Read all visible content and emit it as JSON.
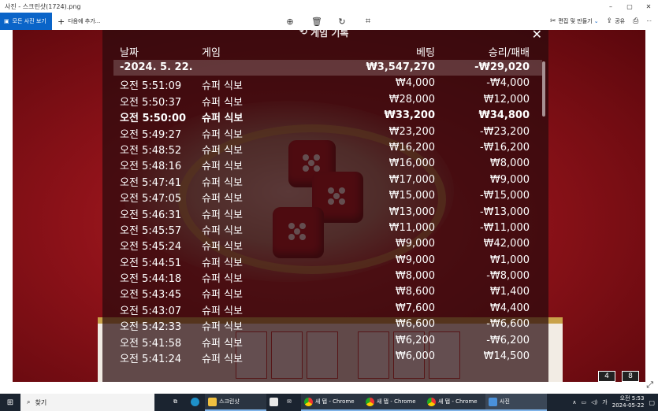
{
  "window": {
    "title": "사진 - 스크린샷(1724).png",
    "controls": [
      "–",
      "▢",
      "✕"
    ]
  },
  "toolbar": {
    "all_photos_label": "모든 사진 보기",
    "add_to_label": "다음에 추가...",
    "edit_label": "편집 및 만들기",
    "share_label": "공유",
    "center_icons": [
      "zoom-in-icon",
      "delete-icon",
      "rotate-icon",
      "crop-icon"
    ]
  },
  "modal": {
    "title": "게임 기록",
    "columns": {
      "date": "날짜",
      "game": "게임",
      "bet": "베팅",
      "win": "승리/패배"
    },
    "summary": {
      "date": "-2024. 5. 22.",
      "bet": "₩3,547,270",
      "win": "-₩29,020"
    },
    "rows": [
      {
        "time": "오전 5:51:09",
        "game": "슈퍼 식보",
        "bet": "₩4,000",
        "win": "-₩4,000"
      },
      {
        "time": "오전 5:50:37",
        "game": "슈퍼 식보",
        "bet": "₩28,000",
        "win": "₩12,000"
      },
      {
        "time": "오전 5:50:00",
        "game": "슈퍼 식보",
        "bet": "₩33,200",
        "win": "₩34,800"
      },
      {
        "time": "오전 5:49:27",
        "game": "슈퍼 식보",
        "bet": "₩23,200",
        "win": "-₩23,200"
      },
      {
        "time": "오전 5:48:52",
        "game": "슈퍼 식보",
        "bet": "₩16,200",
        "win": "-₩16,200"
      },
      {
        "time": "오전 5:48:16",
        "game": "슈퍼 식보",
        "bet": "₩16,000",
        "win": "₩8,000"
      },
      {
        "time": "오전 5:47:41",
        "game": "슈퍼 식보",
        "bet": "₩17,000",
        "win": "₩9,000"
      },
      {
        "time": "오전 5:47:05",
        "game": "슈퍼 식보",
        "bet": "₩15,000",
        "win": "-₩15,000"
      },
      {
        "time": "오전 5:46:31",
        "game": "슈퍼 식보",
        "bet": "₩13,000",
        "win": "-₩13,000"
      },
      {
        "time": "오전 5:45:57",
        "game": "슈퍼 식보",
        "bet": "₩11,000",
        "win": "-₩11,000"
      },
      {
        "time": "오전 5:45:24",
        "game": "슈퍼 식보",
        "bet": "₩9,000",
        "win": "₩42,000"
      },
      {
        "time": "오전 5:44:51",
        "game": "슈퍼 식보",
        "bet": "₩9,000",
        "win": "₩1,000"
      },
      {
        "time": "오전 5:44:18",
        "game": "슈퍼 식보",
        "bet": "₩8,000",
        "win": "-₩8,000"
      },
      {
        "time": "오전 5:43:45",
        "game": "슈퍼 식보",
        "bet": "₩8,600",
        "win": "₩1,400"
      },
      {
        "time": "오전 5:43:07",
        "game": "슈퍼 식보",
        "bet": "₩7,600",
        "win": "₩4,400"
      },
      {
        "time": "오전 5:42:33",
        "game": "슈퍼 식보",
        "bet": "₩6,600",
        "win": "-₩6,600"
      },
      {
        "time": "오전 5:41:58",
        "game": "슈퍼 식보",
        "bet": "₩6,200",
        "win": "-₩6,200"
      },
      {
        "time": "오전 5:41:24",
        "game": "슈퍼 식보",
        "bet": "₩6,000",
        "win": "₩14,500"
      }
    ]
  },
  "taskbar": {
    "search_label": "찾기",
    "apps": [
      {
        "label": "스크린샷",
        "icon": "folder-icon"
      },
      {
        "label": "새 탭 - Chrome",
        "icon": "chrome-icon"
      },
      {
        "label": "새 탭 - Chrome",
        "icon": "chrome-icon"
      },
      {
        "label": "새 탭 - Chrome",
        "icon": "chrome-icon"
      },
      {
        "label": "사진",
        "icon": "photos-icon"
      }
    ],
    "ime": "가",
    "time": "오전 5:53",
    "date": "2024-05-22"
  },
  "colors": {
    "accent": "#0a64c8",
    "taskbar": "#1b2430",
    "felt": "#8e1219"
  }
}
